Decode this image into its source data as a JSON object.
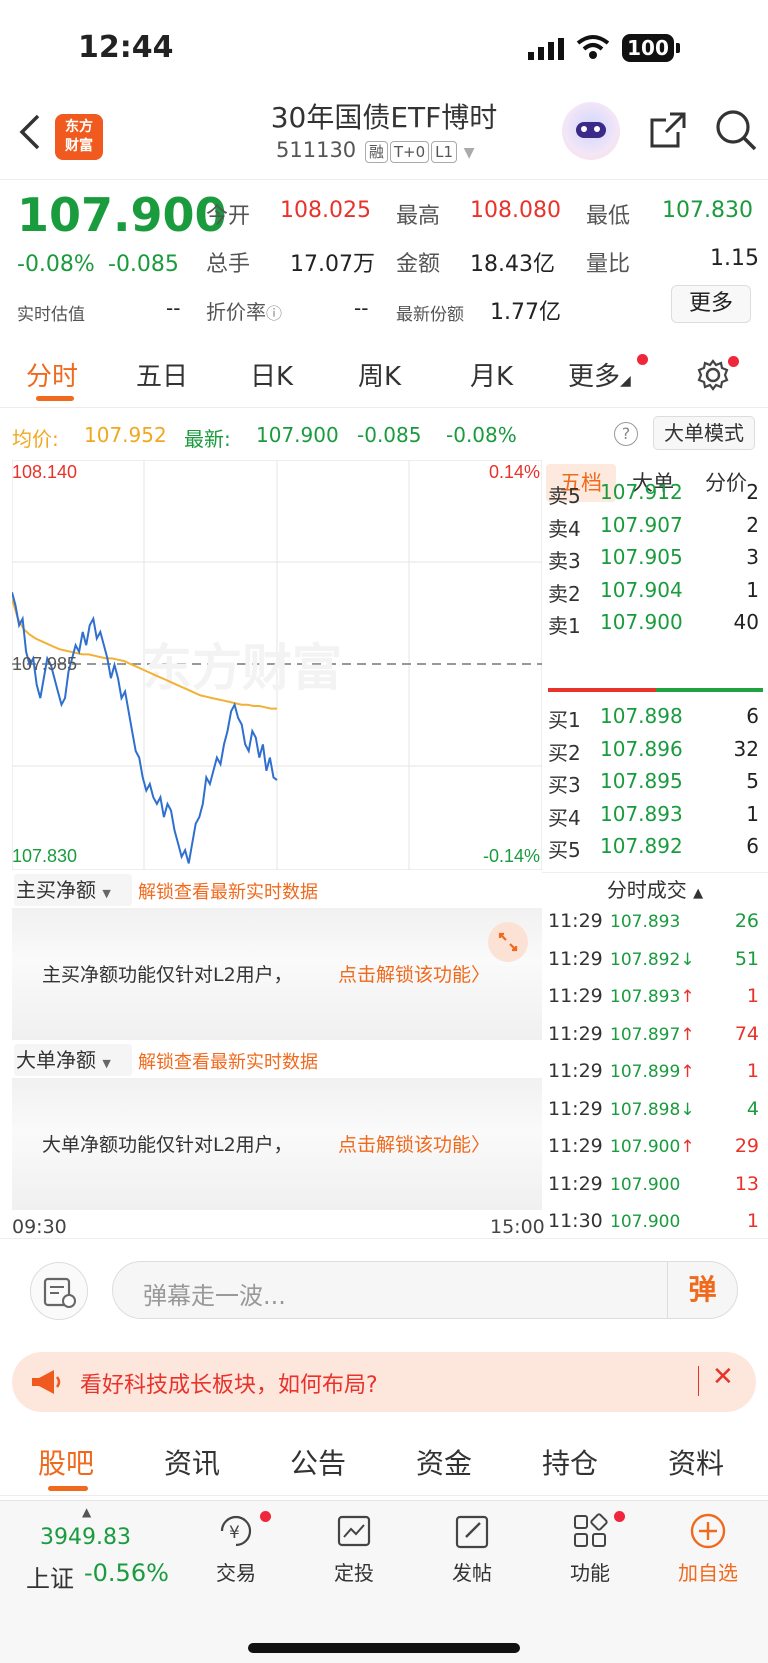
{
  "status": {
    "time": "12:44",
    "battery": "100"
  },
  "header": {
    "logo": "东方\n财富",
    "logo_line1": "东方",
    "logo_line2": "财富",
    "title": "30年国债ETF博时",
    "code": "511130",
    "badges": [
      "融",
      "T+0",
      "L1"
    ]
  },
  "quote": {
    "price": "107.900",
    "change_pct": "-0.08%",
    "change": "-0.085",
    "open_label": "今开",
    "open": "108.025",
    "high_label": "最高",
    "high": "108.080",
    "low_label": "最低",
    "low": "107.830",
    "vol_label": "总手",
    "vol": "17.07万",
    "amount_label": "金额",
    "amount": "18.43亿",
    "ratio_label": "量比",
    "ratio": "1.15",
    "est_label": "实时估值",
    "est": "--",
    "premium_label": "折价率",
    "premium": "--",
    "shares_label": "最新份额",
    "shares": "1.77亿",
    "more_button": "更多"
  },
  "chart_tabs": [
    "分时",
    "五日",
    "日K",
    "周K",
    "月K",
    "更多"
  ],
  "summary": {
    "avg_label": "均价:",
    "avg": "107.952",
    "latest_label": "最新:",
    "latest": "107.900",
    "change": "-0.085",
    "change_pct": "-0.08%",
    "mode_button": "大单模式"
  },
  "chart_data": {
    "type": "line",
    "y_top": "108.140",
    "y_bottom": "107.830",
    "y_mid": "107.985",
    "pct_top": "0.14%",
    "pct_bottom": "-0.14%",
    "x_start": "09:30",
    "x_end": "15:00",
    "ylim": [
      107.83,
      108.14
    ],
    "series": [
      {
        "name": "price",
        "values": [
          108.04,
          108.03,
          108.015,
          108.02,
          107.995,
          107.985,
          107.99,
          107.97,
          107.96,
          107.975,
          107.99,
          107.985,
          107.975,
          107.965,
          107.955,
          107.96,
          107.98,
          107.99,
          108.0,
          107.995,
          108.01,
          108.0,
          108.015,
          108.02,
          108.005,
          108.01,
          108.0,
          107.99,
          107.975,
          107.985,
          107.975,
          107.96,
          107.965,
          107.95,
          107.935,
          107.92,
          107.915,
          107.9,
          107.89,
          107.895,
          107.885,
          107.88,
          107.885,
          107.87,
          107.88,
          107.875,
          107.86,
          107.85,
          107.84,
          107.845,
          107.835,
          107.85,
          107.865,
          107.87,
          107.88,
          107.9,
          107.895,
          107.905,
          107.915,
          107.91,
          107.925,
          107.935,
          107.95,
          107.955,
          107.945,
          107.94,
          107.925,
          107.92,
          107.935,
          107.93,
          107.915,
          107.925,
          107.905,
          107.915,
          107.9,
          107.898
        ]
      },
      {
        "name": "avg",
        "values": [
          108.035,
          108.02,
          108.012,
          108.008,
          108.005,
          108.003,
          108.001,
          107.999,
          107.997,
          107.996,
          107.995,
          107.994,
          107.993,
          107.993,
          107.992,
          107.991,
          107.99,
          107.99,
          107.989,
          107.988,
          107.986,
          107.984,
          107.982,
          107.98,
          107.978,
          107.976,
          107.974,
          107.972,
          107.97,
          107.968,
          107.966,
          107.964,
          107.962,
          107.961,
          107.96,
          107.959,
          107.958,
          107.957,
          107.956,
          107.955,
          107.955,
          107.954,
          107.954,
          107.953,
          107.952,
          107.952
        ]
      }
    ],
    "watermark": "东方财富"
  },
  "orderbook": {
    "tabs": [
      "五档",
      "大单",
      "分价"
    ],
    "asks": [
      {
        "label": "卖5",
        "price": "107.912",
        "vol": "2"
      },
      {
        "label": "卖4",
        "price": "107.907",
        "vol": "2"
      },
      {
        "label": "卖3",
        "price": "107.905",
        "vol": "3"
      },
      {
        "label": "卖2",
        "price": "107.904",
        "vol": "1"
      },
      {
        "label": "卖1",
        "price": "107.900",
        "vol": "40"
      }
    ],
    "bids": [
      {
        "label": "买1",
        "price": "107.898",
        "vol": "6"
      },
      {
        "label": "买2",
        "price": "107.896",
        "vol": "32"
      },
      {
        "label": "买3",
        "price": "107.895",
        "vol": "5"
      },
      {
        "label": "买4",
        "price": "107.893",
        "vol": "1"
      },
      {
        "label": "买5",
        "price": "107.892",
        "vol": "6"
      }
    ]
  },
  "trades": {
    "title": "分时成交",
    "rows": [
      {
        "time": "11:29",
        "price": "107.893",
        "arrow": "",
        "vol": "26",
        "color": "green"
      },
      {
        "time": "11:29",
        "price": "107.892",
        "arrow": "↓",
        "vol": "51",
        "color": "green"
      },
      {
        "time": "11:29",
        "price": "107.893",
        "arrow": "↑",
        "vol": "1",
        "color": "red"
      },
      {
        "time": "11:29",
        "price": "107.897",
        "arrow": "↑",
        "vol": "74",
        "color": "red"
      },
      {
        "time": "11:29",
        "price": "107.899",
        "arrow": "↑",
        "vol": "1",
        "color": "red"
      },
      {
        "time": "11:29",
        "price": "107.898",
        "arrow": "↓",
        "vol": "4",
        "color": "green"
      },
      {
        "time": "11:29",
        "price": "107.900",
        "arrow": "↑",
        "vol": "29",
        "color": "red"
      },
      {
        "time": "11:29",
        "price": "107.900",
        "arrow": "",
        "vol": "13",
        "color": "red"
      },
      {
        "time": "11:30",
        "price": "107.900",
        "arrow": "",
        "vol": "1",
        "color": "red"
      }
    ]
  },
  "panels": {
    "main_net": {
      "label": "主买净额",
      "unlock_hint": "解锁查看最新实时数据",
      "desc": "主买净额功能仅针对L2用户，",
      "link": "点击解锁该功能"
    },
    "big_net": {
      "label": "大单净额",
      "unlock_hint": "解锁查看最新实时数据",
      "desc": "大单净额功能仅针对L2用户，",
      "link": "点击解锁该功能"
    }
  },
  "danmaku": {
    "placeholder": "弹幕走一波...",
    "button": "弹"
  },
  "banner": {
    "text": "看好科技成长板块，如何布局?"
  },
  "bottom_tabs": [
    "股吧",
    "资讯",
    "公告",
    "资金",
    "持仓",
    "资料"
  ],
  "index": {
    "value": "3949.83",
    "name": "上证",
    "change": "-0.56%"
  },
  "nav": [
    "交易",
    "定投",
    "发帖",
    "功能",
    "加自选"
  ]
}
